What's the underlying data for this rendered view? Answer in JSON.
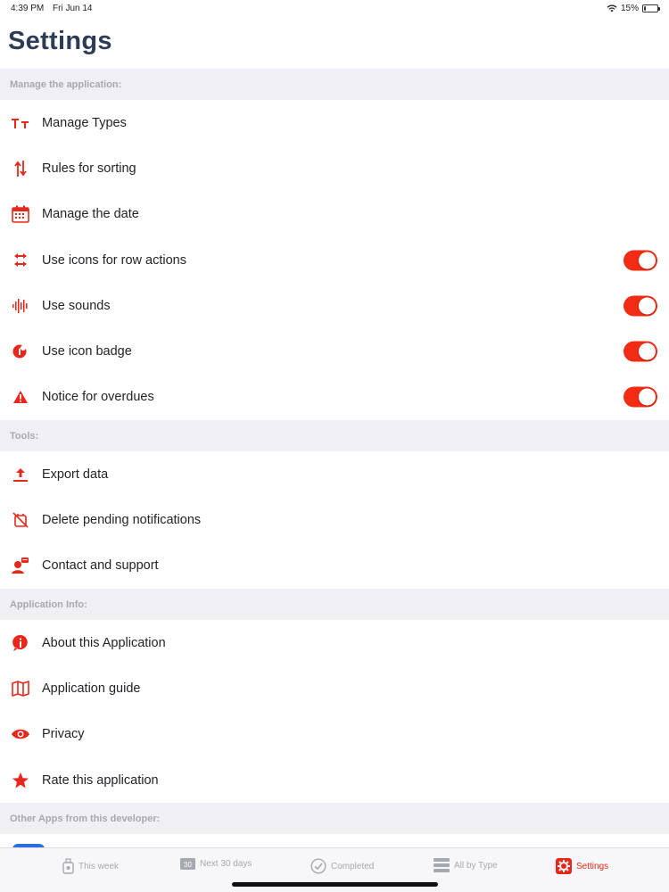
{
  "status_bar": {
    "time": "4:39 PM",
    "date": "Fri Jun 14",
    "battery": "15%",
    "battery_level": 0.15
  },
  "page_title": "Settings",
  "sections": [
    {
      "header": "Manage the application:",
      "rows": [
        {
          "label": "Manage Types",
          "icon": "type-icon"
        },
        {
          "label": "Rules for sorting",
          "icon": "sort-arrows-icon"
        },
        {
          "label": "Manage the date",
          "icon": "calendar-icon"
        },
        {
          "label": "Use icons for row actions",
          "icon": "row-actions-icon",
          "toggle": true
        },
        {
          "label": "Use sounds",
          "icon": "sound-wave-icon",
          "toggle": true
        },
        {
          "label": "Use icon badge",
          "icon": "badge-icon",
          "toggle": true
        },
        {
          "label": "Notice for overdues",
          "icon": "warning-icon",
          "toggle": true
        }
      ]
    },
    {
      "header": "Tools:",
      "rows": [
        {
          "label": "Export data",
          "icon": "export-icon"
        },
        {
          "label": "Delete pending notifications",
          "icon": "notification-off-icon"
        },
        {
          "label": "Contact and support",
          "icon": "support-icon"
        }
      ]
    },
    {
      "header": "Application Info:",
      "rows": [
        {
          "label": "About this Application",
          "icon": "info-icon"
        },
        {
          "label": "Application guide",
          "icon": "map-guide-icon"
        },
        {
          "label": "Privacy",
          "icon": "eye-icon"
        },
        {
          "label": "Rate this application",
          "icon": "star-icon"
        }
      ]
    },
    {
      "header": "Other Apps from this developer:",
      "rows": []
    }
  ],
  "tab_bar": {
    "tabs": [
      {
        "label": "This week",
        "icon": "this-week-icon"
      },
      {
        "label": "Next 30 days",
        "icon": "next-30-days-icon",
        "badge": "30"
      },
      {
        "label": "Completed",
        "icon": "completed-check-icon"
      },
      {
        "label": "All by Type",
        "icon": "all-by-type-icon"
      },
      {
        "label": "Settings",
        "icon": "settings-gear-icon",
        "active": true
      }
    ]
  },
  "colors": {
    "accent": "#e8261a",
    "toggle_on": "#f22b15",
    "section_bg": "#efeff4",
    "title": "#2d3b55",
    "inactive_tab": "#a7a9b0"
  }
}
